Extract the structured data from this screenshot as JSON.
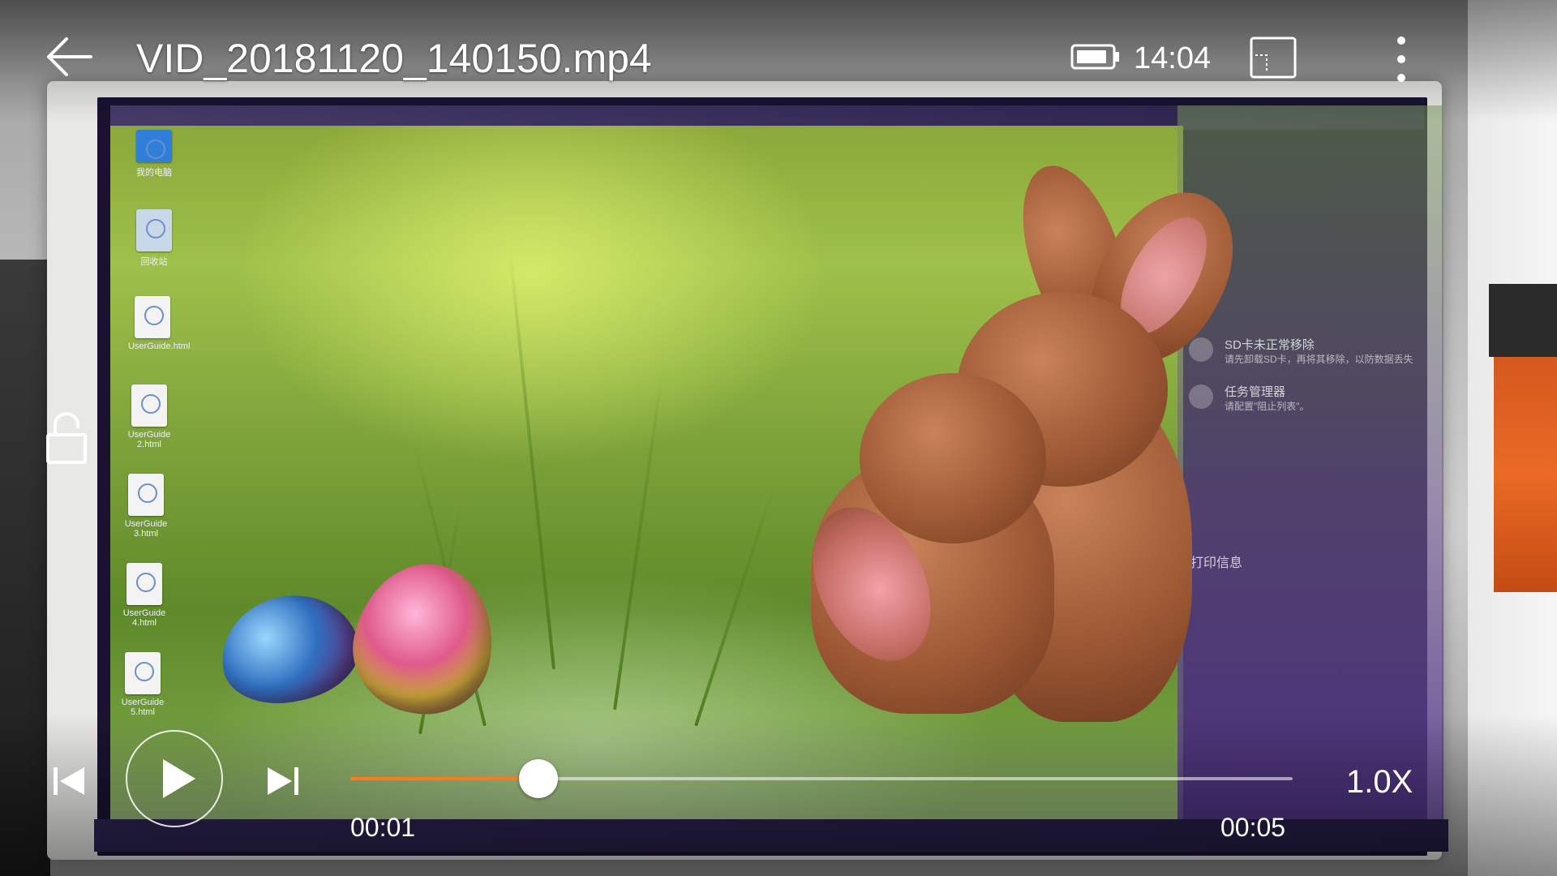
{
  "player": {
    "title": "VID_20181120_140150.mp4",
    "status_time": "14:04",
    "current_time": "00:01",
    "total_time": "00:05",
    "progress": 0.2,
    "speed": "1.0X",
    "accent_color": "#ff7a1a"
  },
  "icons": {
    "back": "back-arrow-icon",
    "battery": "battery-icon",
    "window": "floating-window-icon",
    "more": "more-vertical-icon",
    "lock": "unlock-icon",
    "prev": "skip-previous-icon",
    "play": "play-icon",
    "next": "skip-next-icon"
  },
  "video_frame": {
    "desktop_icons": [
      "我的电脑",
      "回收站",
      "UserGuide.html",
      "UserGuide 2.html",
      "UserGuide 3.html",
      "UserGuide 4.html",
      "UserGuide 5.html"
    ],
    "notifications": [
      {
        "title": "SD卡未正常移除",
        "sub": "请先卸载SD卡，再将其移除，以防数据丢失"
      },
      {
        "title": "任务管理器",
        "sub": "请配置\"阻止列表\"。"
      }
    ],
    "panel_text": "打印信息"
  }
}
